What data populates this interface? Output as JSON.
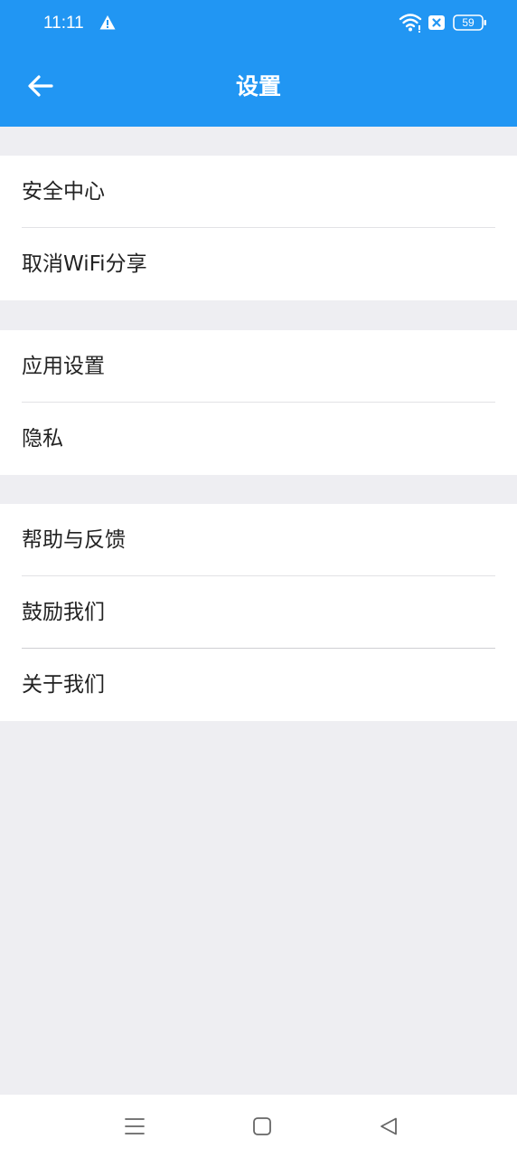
{
  "status_bar": {
    "time": "11:11",
    "battery_level": "59",
    "icons": [
      "warning-icon",
      "wifi-icon",
      "sim-error-icon",
      "battery-icon"
    ]
  },
  "header": {
    "title": "设置",
    "back_icon": "arrow-left-icon"
  },
  "groups": [
    {
      "items": [
        {
          "label": "安全中心"
        },
        {
          "label": "取消WiFi分享"
        }
      ]
    },
    {
      "items": [
        {
          "label": "应用设置"
        },
        {
          "label": "隐私"
        }
      ]
    },
    {
      "items": [
        {
          "label": "帮助与反馈"
        },
        {
          "label": "鼓励我们"
        },
        {
          "label": "关于我们"
        }
      ]
    }
  ],
  "nav_bar": {
    "icons": [
      "menu-icon",
      "home-icon",
      "back-triangle-icon"
    ]
  },
  "colors": {
    "primary": "#2196f3",
    "background": "#eeeef2",
    "text": "#222222",
    "divider": "#e2e2e6"
  }
}
